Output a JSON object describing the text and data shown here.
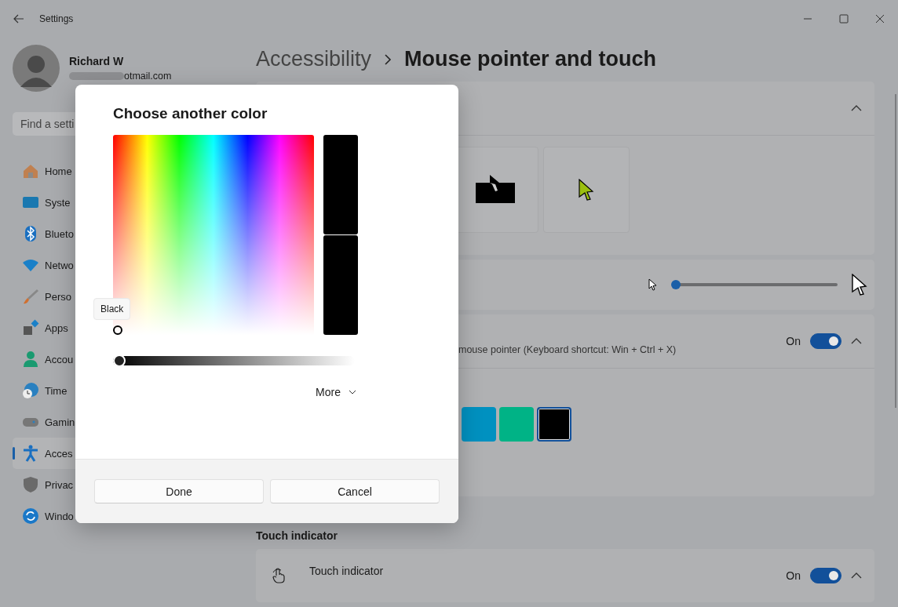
{
  "window": {
    "title": "Settings"
  },
  "profile": {
    "name": "Richard W",
    "email": "otmail.com"
  },
  "search": {
    "placeholder": "Find a setti"
  },
  "nav": [
    {
      "label": "Home",
      "selected": false
    },
    {
      "label": "Syste",
      "selected": false
    },
    {
      "label": "Blueto",
      "selected": false
    },
    {
      "label": "Netwo",
      "selected": false
    },
    {
      "label": "Perso",
      "selected": false
    },
    {
      "label": "Apps",
      "selected": false
    },
    {
      "label": "Accou",
      "selected": false
    },
    {
      "label": "Time",
      "selected": false
    },
    {
      "label": "Gamin",
      "selected": false
    },
    {
      "label": "Acces",
      "selected": true
    },
    {
      "label": "Privac",
      "selected": false
    },
    {
      "label": "Windo",
      "selected": false
    }
  ],
  "breadcrumb": {
    "parent": "Accessibility",
    "current": "Mouse pointer and touch"
  },
  "pointer_style": {
    "expanded": true,
    "tiles": [
      {
        "kind": "inverted",
        "selected": false
      },
      {
        "kind": "custom",
        "selected": false
      }
    ]
  },
  "size": {
    "level": 0
  },
  "indicator": {
    "description": "mouse pointer (Keyboard shortcut: Win + Ctrl + X)",
    "toggle_label": "On",
    "on": true,
    "expanded": true,
    "swatches": [
      {
        "color": "#0091c0",
        "selected": false
      },
      {
        "color": "#00b386",
        "selected": false
      },
      {
        "color": "#000000",
        "selected": true
      }
    ]
  },
  "touch": {
    "heading": "Touch indicator",
    "title": "Touch indicator",
    "toggle_label": "On",
    "on": true,
    "expanded": true
  },
  "dialog": {
    "title": "Choose another color",
    "tooltip": "Black",
    "value_slider": {
      "level": 0
    },
    "more": "More",
    "buttons": [
      "Done",
      "Cancel"
    ]
  }
}
